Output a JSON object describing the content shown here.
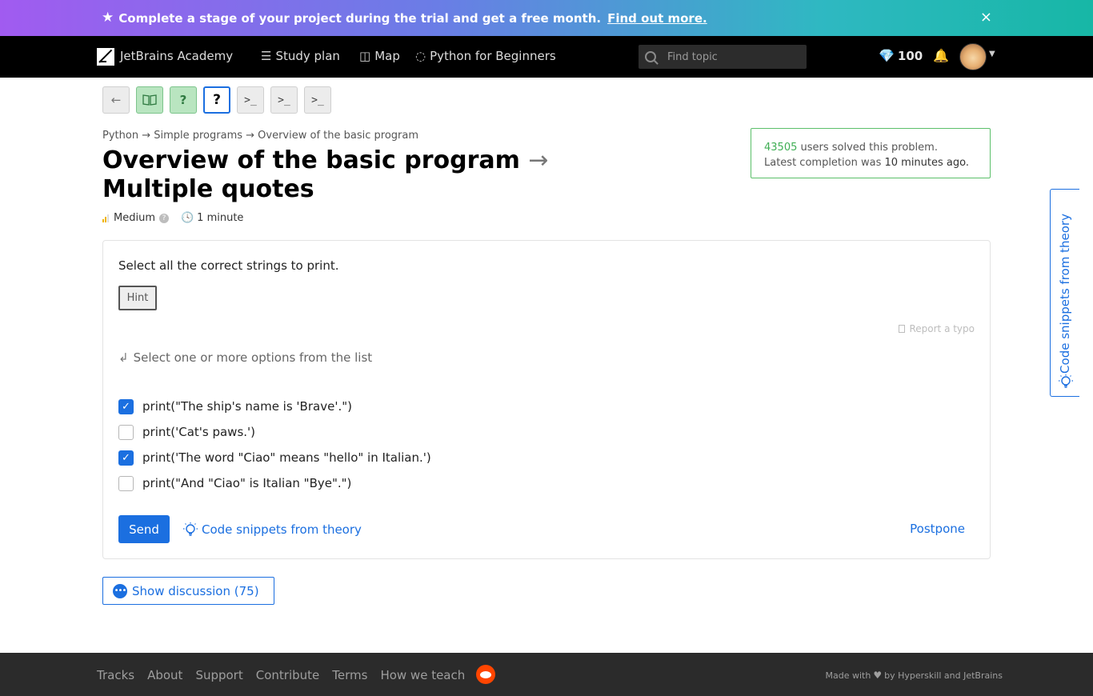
{
  "banner": {
    "text": "Complete a stage of your project during the trial and get a free month.",
    "link": "Find out more.",
    "close": "×"
  },
  "nav": {
    "brand": "JetBrains Academy",
    "study_plan": "Study plan",
    "map": "Map",
    "track": "Python for Beginners",
    "search_placeholder": "Find topic",
    "gems": "100"
  },
  "steps": {
    "back": "←",
    "theory": "📖",
    "done": "?",
    "current": "?",
    "code1": ">_",
    "code2": ">_",
    "code3": ">_"
  },
  "breadcrumb": "Python → Simple programs → Overview of the basic program",
  "title": {
    "part1": "Overview of the basic program",
    "arrow": "→",
    "part2": "Multiple quotes"
  },
  "meta": {
    "difficulty": "Medium",
    "help": "?",
    "time": "1 minute"
  },
  "stats": {
    "count": "43505",
    "solved_text": "users solved this problem.",
    "latest_prefix": "Latest completion was",
    "latest_time": "10 minutes ago."
  },
  "side_tab": {
    "label": "Code snippets from theory"
  },
  "question": {
    "prompt": "Select all the correct strings to print.",
    "hint": "Hint",
    "report": "Report a typo",
    "instruction": "Select one or more options from the list",
    "options": [
      {
        "text": "print(\"The ship's name is 'Brave'.\")",
        "checked": true
      },
      {
        "text": "print('Cat's paws.')",
        "checked": false
      },
      {
        "text": "print('The word \"Ciao\" means \"hello\" in Italian.')",
        "checked": true
      },
      {
        "text": "print(\"And \"Ciao\" is Italian \"Bye\".\")",
        "checked": false
      }
    ],
    "send": "Send",
    "snippets": "Code snippets from theory",
    "postpone": "Postpone"
  },
  "discussion": {
    "label": "Show discussion (75)"
  },
  "footer": {
    "links": [
      "Tracks",
      "About",
      "Support",
      "Contribute",
      "Terms",
      "How we teach"
    ],
    "made_prefix": "Made with",
    "made_suffix": "by Hyperskill and JetBrains"
  },
  "colors": {
    "accent": "#1b6fe0",
    "success": "#5bbf6a",
    "gem": "#d24bf0",
    "footer_bg": "#2b2b2b"
  }
}
